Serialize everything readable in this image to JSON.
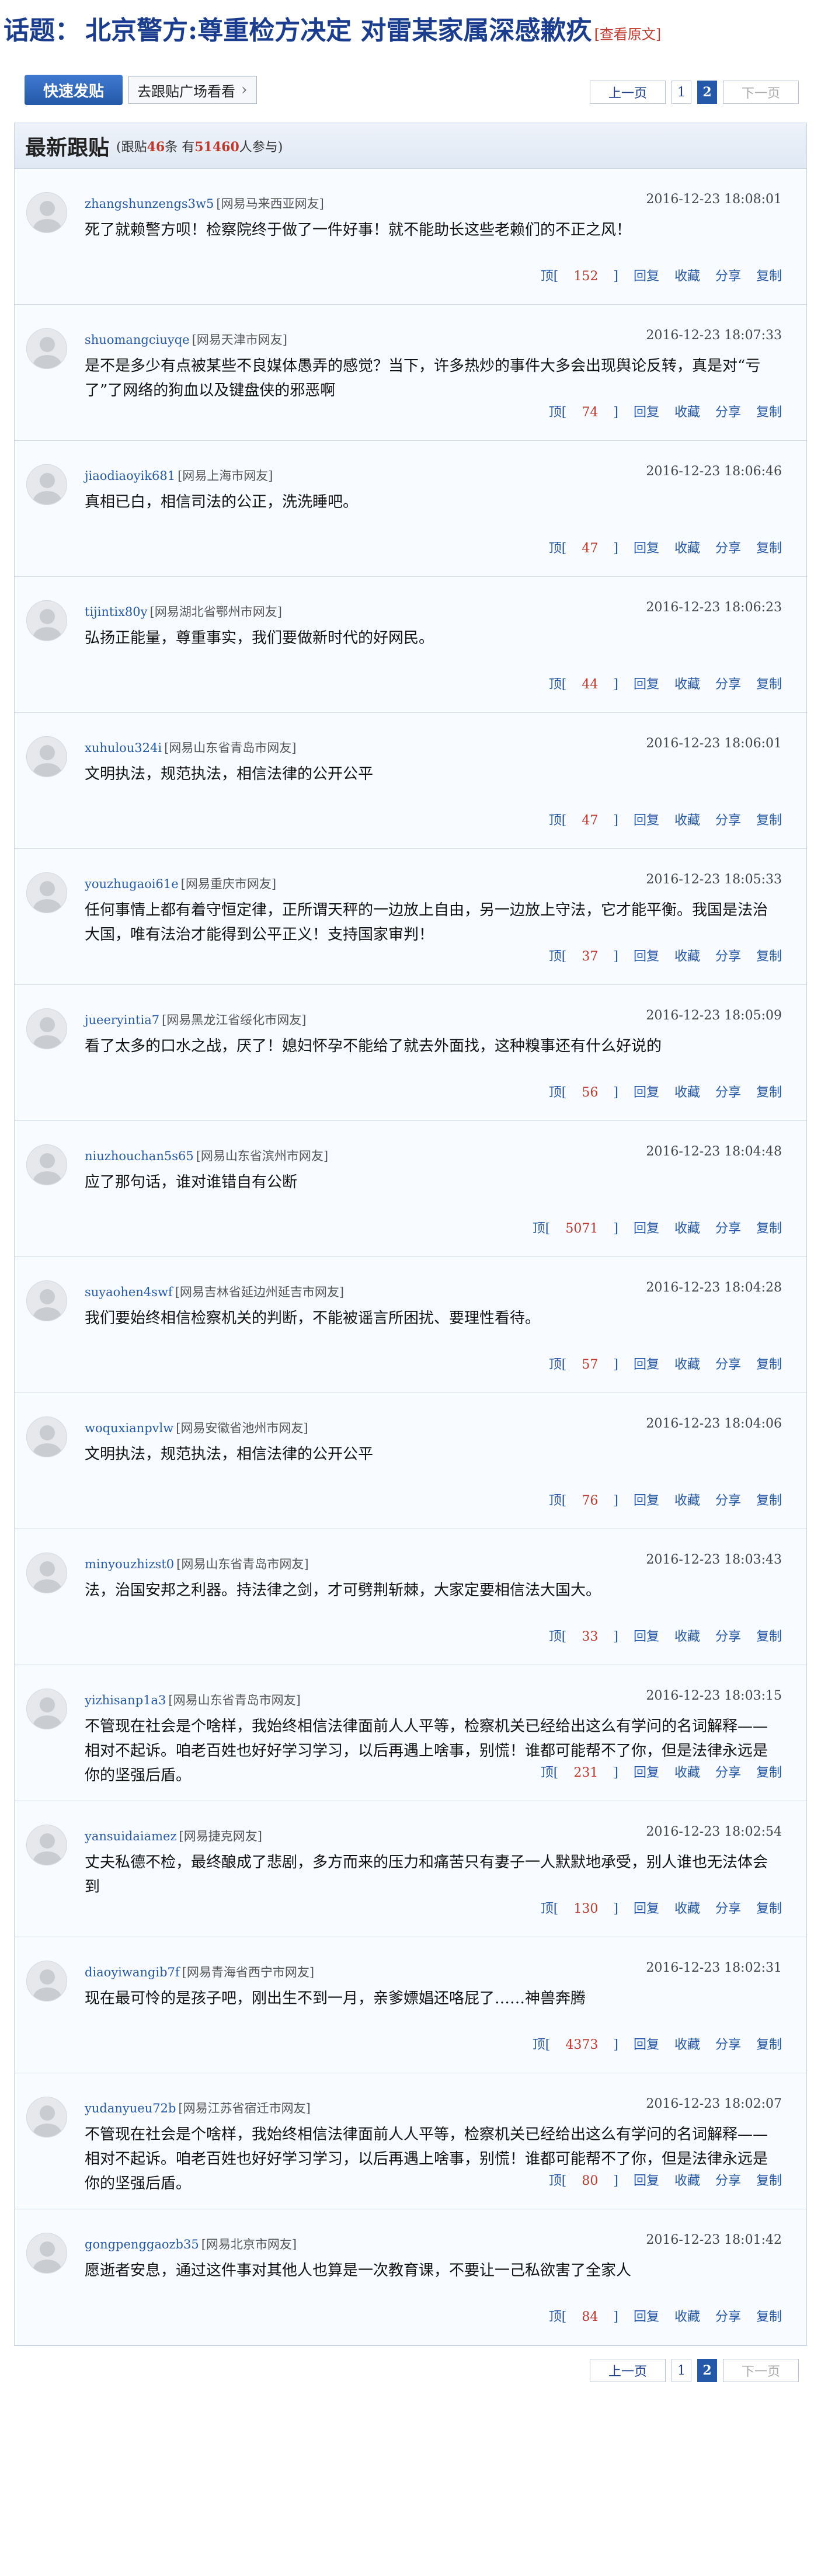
{
  "topic": {
    "prefix": "话题：",
    "title": "北京警方:尊重检方决定 对雷某家属深感歉疚",
    "view_original": "[查看原文]"
  },
  "toolbar": {
    "post_button": "快速发贴",
    "square_button": "去跟贴广场看看",
    "pager": {
      "prev": "上一页",
      "page1": "1",
      "page2": "2",
      "next": "下一页"
    }
  },
  "section": {
    "heading": "最新跟贴",
    "stat_prefix": "(跟贴",
    "reply_count": "46",
    "stat_mid": "条 有",
    "participant_count": "51460",
    "stat_suffix": "人参与)"
  },
  "actions": {
    "up_prefix": "顶[",
    "up_suffix": "]",
    "reply": "回复",
    "collect": "收藏",
    "share": "分享",
    "copy": "复制"
  },
  "replies": [
    {
      "user": "zhangshunzengs3w5",
      "location": "[网易马来西亚网友]",
      "time": "2016-12-23 18:08:01",
      "content": "死了就赖警方呗！检察院终于做了一件好事！就不能助长这些老赖们的不正之风！",
      "up": "152"
    },
    {
      "user": "shuomangciuyqe",
      "location": "[网易天津市网友]",
      "time": "2016-12-23 18:07:33",
      "content": "是不是多少有点被某些不良媒体愚弄的感觉？当下，许多热炒的事件大多会出现舆论反转，真是对“亏了”了网络的狗血以及键盘侠的邪恶啊",
      "up": "74"
    },
    {
      "user": "jiaodiaoyik681",
      "location": "[网易上海市网友]",
      "time": "2016-12-23 18:06:46",
      "content": "真相已白，相信司法的公正，洗洗睡吧。",
      "up": "47"
    },
    {
      "user": "tijintix80y",
      "location": "[网易湖北省鄂州市网友]",
      "time": "2016-12-23 18:06:23",
      "content": "弘扬正能量，尊重事实，我们要做新时代的好网民。",
      "up": "44"
    },
    {
      "user": "xuhulou324i",
      "location": "[网易山东省青岛市网友]",
      "time": "2016-12-23 18:06:01",
      "content": "文明执法，规范执法，相信法律的公开公平",
      "up": "47"
    },
    {
      "user": "youzhugaoi61e",
      "location": "[网易重庆市网友]",
      "time": "2016-12-23 18:05:33",
      "content": "任何事情上都有着守恒定律，正所谓天秤的一边放上自由，另一边放上守法，它才能平衡。我国是法治大国，唯有法治才能得到公平正义！支持国家审判！",
      "up": "37"
    },
    {
      "user": "jueeryintia7",
      "location": "[网易黑龙江省绥化市网友]",
      "time": "2016-12-23 18:05:09",
      "content": "看了太多的口水之战，厌了！媳妇怀孕不能给了就去外面找，这种糗事还有什么好说的",
      "up": "56"
    },
    {
      "user": "niuzhouchan5s65",
      "location": "[网易山东省滨州市网友]",
      "time": "2016-12-23 18:04:48",
      "content": "应了那句话，谁对谁错自有公断",
      "up": "5071"
    },
    {
      "user": "suyaohen4swf",
      "location": "[网易吉林省延边州延吉市网友]",
      "time": "2016-12-23 18:04:28",
      "content": "我们要始终相信检察机关的判断，不能被谣言所困扰、要理性看待。",
      "up": "57"
    },
    {
      "user": "woquxianpvlw",
      "location": "[网易安徽省池州市网友]",
      "time": "2016-12-23 18:04:06",
      "content": "文明执法，规范执法，相信法律的公开公平",
      "up": "76"
    },
    {
      "user": "minyouzhizst0",
      "location": "[网易山东省青岛市网友]",
      "time": "2016-12-23 18:03:43",
      "content": "法，治国安邦之利器。持法律之剑，才可劈荆斩棘，大家定要相信法大国大。",
      "up": "33"
    },
    {
      "user": "yizhisanp1a3",
      "location": "[网易山东省青岛市网友]",
      "time": "2016-12-23 18:03:15",
      "content": "不管现在社会是个啥样，我始终相信法律面前人人平等，检察机关已经给出这么有学问的名词解释——相对不起诉。咱老百姓也好好学习学习，以后再遇上啥事，别慌！谁都可能帮不了你，但是法律永远是你的坚强后盾。",
      "up": "231"
    },
    {
      "user": "yansuidaiamez",
      "location": "[网易捷克网友]",
      "time": "2016-12-23 18:02:54",
      "content": "丈夫私德不检，最终酿成了悲剧，多方而来的压力和痛苦只有妻子一人默默地承受，别人谁也无法体会到",
      "up": "130"
    },
    {
      "user": "diaoyiwangib7f",
      "location": "[网易青海省西宁市网友]",
      "time": "2016-12-23 18:02:31",
      "content": "现在最可怜的是孩子吧，刚出生不到一月，亲爹嫖娼还咯屁了……神兽奔腾",
      "up": "4373"
    },
    {
      "user": "yudanyueu72b",
      "location": "[网易江苏省宿迁市网友]",
      "time": "2016-12-23 18:02:07",
      "content": "不管现在社会是个啥样，我始终相信法律面前人人平等，检察机关已经给出这么有学问的名词解释——相对不起诉。咱老百姓也好好学习学习，以后再遇上啥事，别慌！谁都可能帮不了你，但是法律永远是你的坚强后盾。",
      "up": "80"
    },
    {
      "user": "gongpenggaozb35",
      "location": "[网易北京市网友]",
      "time": "2016-12-23 18:01:42",
      "content": "愿逝者安息，通过这件事对其他人也算是一次教育课，不要让一己私欲害了全家人",
      "up": "84"
    }
  ],
  "colors": {
    "brand_blue": "#1a3d8f",
    "link_blue": "#2458a8",
    "count_red": "#c0392b"
  }
}
